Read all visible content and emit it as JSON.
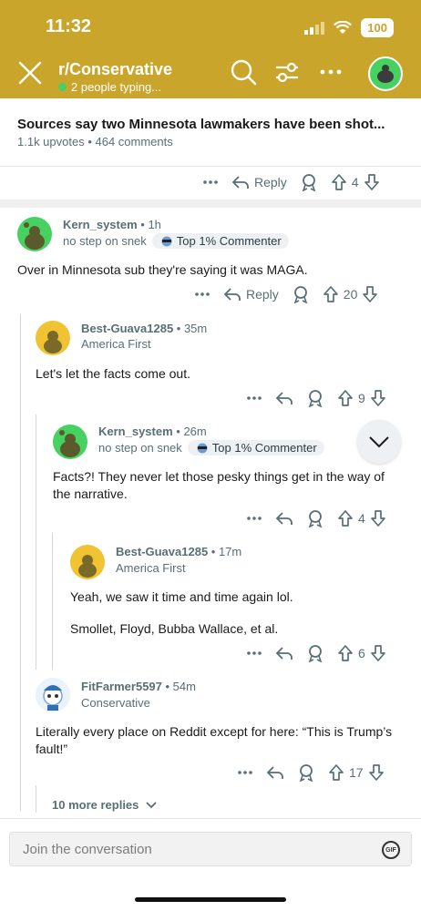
{
  "status": {
    "time": "11:32",
    "battery": "100"
  },
  "header": {
    "subreddit": "r/Conservative",
    "typing": "2 people typing..."
  },
  "post": {
    "title": "Sources say two Minnesota lawmakers have been shot...",
    "meta": "1.1k upvotes • 464 comments",
    "reply_label": "Reply",
    "votes": "4"
  },
  "comments": [
    {
      "user": "Kern_system",
      "age": "1h",
      "flair": "no step on snek",
      "badge": "Top 1% Commenter",
      "text": "Over in Minnesota sub they're saying it was MAGA.",
      "reply_label": "Reply",
      "votes": "20"
    },
    {
      "user": "Best-Guava1285",
      "age": "35m",
      "flair": "America First",
      "text": "Let's let the facts come out.",
      "votes": "9"
    },
    {
      "user": "Kern_system",
      "age": "26m",
      "flair": "no step on snek",
      "badge": "Top 1% Commenter",
      "text": "Facts?! They never let those pesky things get in the way of the narrative.",
      "votes": "4"
    },
    {
      "user": "Best-Guava1285",
      "age": "17m",
      "flair": "America First",
      "text1": "Yeah, we saw it time and time again lol.",
      "text2": "Smollet, Floyd, Bubba Wallace, et al.",
      "votes": "6"
    },
    {
      "user": "FitFarmer5597",
      "age": "54m",
      "flair": "Conservative",
      "text": "Literally every place on Reddit except for here: “This is Trump’s fault!”",
      "votes": "17"
    }
  ],
  "more_replies": "10 more replies",
  "composer": {
    "placeholder": "Join the conversation",
    "gif": "GIF"
  },
  "colors": {
    "header_bg": "#c9a52c",
    "green_avatar": "#46d160",
    "yellow_avatar": "#f1c232"
  }
}
